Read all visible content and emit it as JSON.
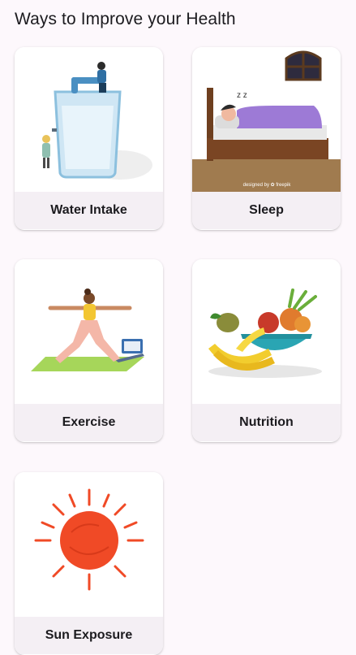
{
  "header": {
    "title": "Ways to Improve your Health"
  },
  "cards": [
    {
      "label": "Water Intake",
      "image": "water-glass-illustration"
    },
    {
      "label": "Sleep",
      "image": "sleeping-person-illustration",
      "credit": "designed by ✿ freepik"
    },
    {
      "label": "Exercise",
      "image": "yoga-pose-illustration"
    },
    {
      "label": "Nutrition",
      "image": "fruit-bowl-illustration"
    },
    {
      "label": "Sun Exposure",
      "image": "sun-illustration"
    }
  ]
}
